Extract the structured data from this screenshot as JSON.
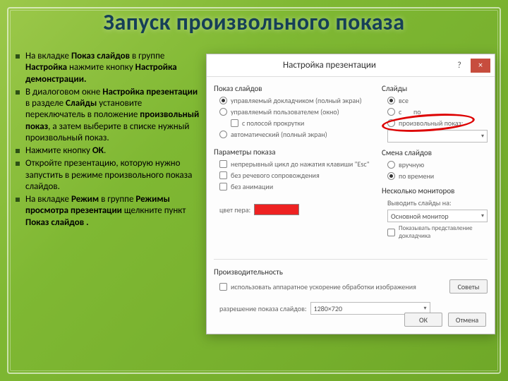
{
  "title": "Запуск произвольного показа",
  "bullets": [
    {
      "pre": "На вкладке ",
      "b1": "Показ слайдов",
      "mid1": " в группе ",
      "b2": "Настройка",
      "mid2": " нажмите кнопку ",
      "b3": "Настройка демонстрации.",
      "tail": ""
    },
    {
      "pre": "В диалоговом окне ",
      "b1": "Настройка презентации",
      "mid1": " в разделе ",
      "b2": "Слайды",
      "mid2": " установите переключатель в положение ",
      "b3": "произвольный показ",
      "tail": ", а затем выберите в списке нужный произвольный показ."
    },
    {
      "pre": "Нажмите кнопку ",
      "b1": "ОК",
      "mid1": ".",
      "b2": "",
      "mid2": "",
      "b3": "",
      "tail": ""
    },
    {
      "pre": "Откройте презентацию, которую нужно запустить в режиме произвольного показа слайдов.",
      "b1": "",
      "mid1": "",
      "b2": "",
      "mid2": "",
      "b3": "",
      "tail": ""
    },
    {
      "pre": "На вкладке ",
      "b1": "Режим",
      "mid1": " в группе ",
      "b2": "Режимы просмотра презентации",
      "mid2": " щелкните пункт ",
      "b3": "Показ слайдов .",
      "tail": ""
    }
  ],
  "dlg": {
    "title": "Настройка презентации",
    "help": "?",
    "close": "×",
    "g_show": "Показ слайдов",
    "r_presenter": "управляемый докладчиком (полный экран)",
    "r_browsed": "управляемый пользователем (окно)",
    "c_scroll": "с полосой прокрутки",
    "r_kiosk": "автоматический (полный экран)",
    "g_slides": "Слайды",
    "r_all": "все",
    "r_from": "с",
    "r_to": "по",
    "r_custom": "произвольный показ:",
    "g_options": "Параметры показа",
    "c_loop": "непрерывный цикл до нажатия клавиши \"Esc\"",
    "c_nonarr": "без речевого сопровождения",
    "c_noanim": "без анимации",
    "l_pen": "цвет пера:",
    "g_advance": "Смена слайдов",
    "r_manual": "вручную",
    "r_timed": "по времени",
    "g_mon": "Несколько мониторов",
    "l_mon": "Выводить слайды на:",
    "mon_val": "Основной монитор",
    "c_pview": "Показывать представление докладчика",
    "g_perf": "Производительность",
    "c_hw": "использовать аппаратное ускорение обработки изображения",
    "l_res": "разрешение показа слайдов:",
    "res_val": "1280×720",
    "tips": "Советы",
    "ok": "ОК",
    "cancel": "Отмена"
  }
}
